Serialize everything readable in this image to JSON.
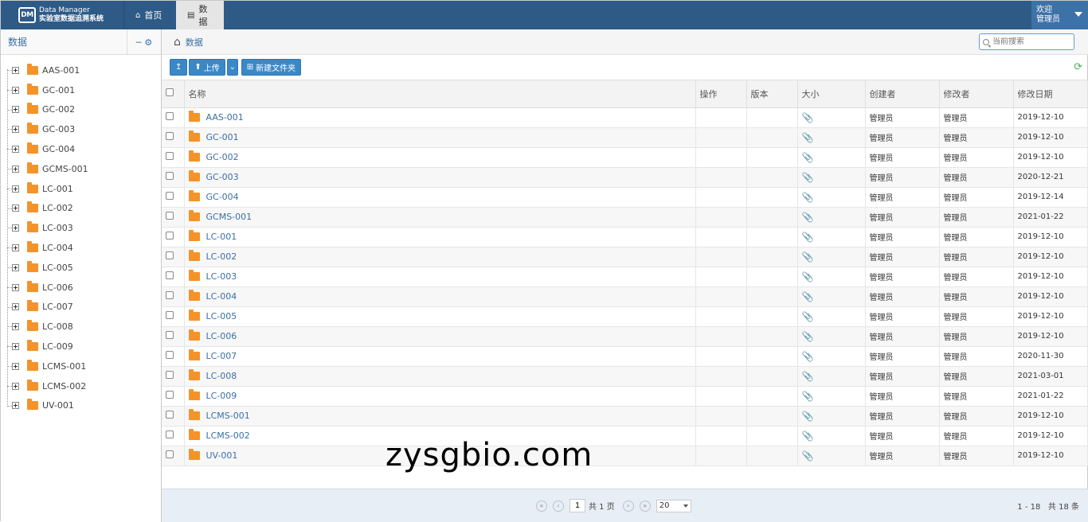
{
  "app": {
    "brand_en": "Data Manager",
    "brand_cn": "实验室数据追溯系统",
    "brand_logo": "DM",
    "tabs": [
      {
        "label": "首页",
        "icon": "home-icon"
      },
      {
        "label": "数据",
        "icon": "database-icon"
      }
    ],
    "user_line1": "欢迎",
    "user_line2": "管理员"
  },
  "sidebar": {
    "title": "数据",
    "items": [
      "AAS-001",
      "GC-001",
      "GC-002",
      "GC-003",
      "GC-004",
      "GCMS-001",
      "LC-001",
      "LC-002",
      "LC-003",
      "LC-004",
      "LC-005",
      "LC-006",
      "LC-007",
      "LC-008",
      "LC-009",
      "LCMS-001",
      "LCMS-002",
      "UV-001"
    ]
  },
  "breadcrumb": {
    "label": "数据"
  },
  "search": {
    "placeholder": "当前搜索"
  },
  "toolbar": {
    "up_label": "↥",
    "upload_label": "上传",
    "new_folder_label": "新建文件夹"
  },
  "table": {
    "headers": {
      "name": "名称",
      "action": "操作",
      "version": "版本",
      "size": "大小",
      "creator": "创建者",
      "modifier": "修改者",
      "date": "修改日期"
    },
    "rows": [
      {
        "name": "AAS-001",
        "creator": "管理员",
        "modifier": "管理员",
        "date": "2019-12-10"
      },
      {
        "name": "GC-001",
        "creator": "管理员",
        "modifier": "管理员",
        "date": "2019-12-10"
      },
      {
        "name": "GC-002",
        "creator": "管理员",
        "modifier": "管理员",
        "date": "2019-12-10"
      },
      {
        "name": "GC-003",
        "creator": "管理员",
        "modifier": "管理员",
        "date": "2020-12-21"
      },
      {
        "name": "GC-004",
        "creator": "管理员",
        "modifier": "管理员",
        "date": "2019-12-14"
      },
      {
        "name": "GCMS-001",
        "creator": "管理员",
        "modifier": "管理员",
        "date": "2021-01-22"
      },
      {
        "name": "LC-001",
        "creator": "管理员",
        "modifier": "管理员",
        "date": "2019-12-10"
      },
      {
        "name": "LC-002",
        "creator": "管理员",
        "modifier": "管理员",
        "date": "2019-12-10"
      },
      {
        "name": "LC-003",
        "creator": "管理员",
        "modifier": "管理员",
        "date": "2019-12-10"
      },
      {
        "name": "LC-004",
        "creator": "管理员",
        "modifier": "管理员",
        "date": "2019-12-10"
      },
      {
        "name": "LC-005",
        "creator": "管理员",
        "modifier": "管理员",
        "date": "2019-12-10"
      },
      {
        "name": "LC-006",
        "creator": "管理员",
        "modifier": "管理员",
        "date": "2019-12-10"
      },
      {
        "name": "LC-007",
        "creator": "管理员",
        "modifier": "管理员",
        "date": "2020-11-30"
      },
      {
        "name": "LC-008",
        "creator": "管理员",
        "modifier": "管理员",
        "date": "2021-03-01"
      },
      {
        "name": "LC-009",
        "creator": "管理员",
        "modifier": "管理员",
        "date": "2021-01-22"
      },
      {
        "name": "LCMS-001",
        "creator": "管理员",
        "modifier": "管理员",
        "date": "2019-12-10"
      },
      {
        "name": "LCMS-002",
        "creator": "管理员",
        "modifier": "管理员",
        "date": "2019-12-10"
      },
      {
        "name": "UV-001",
        "creator": "管理员",
        "modifier": "管理员",
        "date": "2019-12-10"
      }
    ]
  },
  "pager": {
    "page": "1",
    "total_pages_text": "共 1 页",
    "page_size": "20",
    "range_text": "1 - 18",
    "total_text": "共 18 条"
  },
  "watermark": "zysgbio.com",
  "colors": {
    "header": "#2e5a86",
    "accent": "#3b88c8",
    "folder": "#f4932a",
    "link": "#3a6fa6"
  }
}
